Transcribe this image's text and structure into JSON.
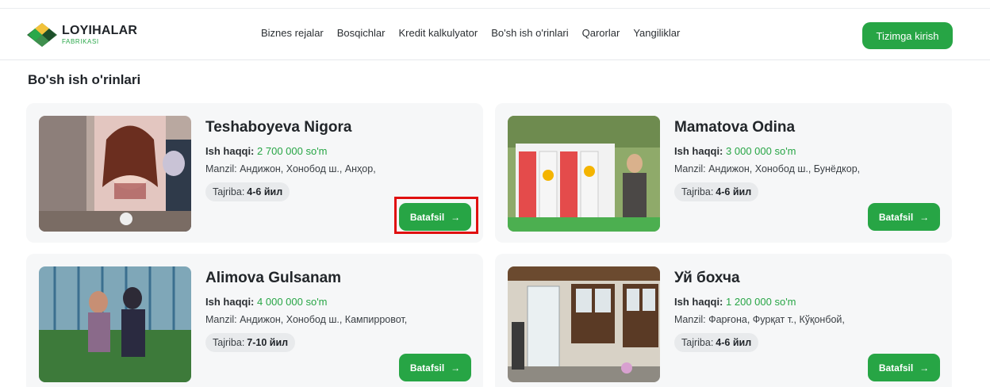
{
  "brand": {
    "title": "LOYIHALAR",
    "subtitle": "FABRIKASI"
  },
  "nav": [
    "Biznes rejalar",
    "Bosqichlar",
    "Kredit kalkulyator",
    "Bo'sh ish o'rinlari",
    "Qarorlar",
    "Yangiliklar"
  ],
  "login_label": "Tizimga kirish",
  "page_title": "Bo'sh ish o'rinlari",
  "labels": {
    "salary": "Ish haqqi:",
    "address": "Manzil:",
    "experience": "Tajriba:",
    "more": "Batafsil",
    "arrow": "→"
  },
  "jobs": [
    {
      "name": "Teshaboyeva Nigora",
      "salary": "2 700 000 so'm",
      "address": "Андижон, Хонобод ш., Анҳор,",
      "experience": "4-6 йил",
      "photo": "beauty-salon-photo"
    },
    {
      "name": "Mamatova Odina",
      "salary": "3 000 000 so'm",
      "address": "Андижон, Хонобод ш., Бунёдкор,",
      "experience": "4-6 йил",
      "photo": "kindergarten-photo"
    },
    {
      "name": "Alimova Gulsanam",
      "salary": "4 000 000 so'm",
      "address": "Андижон, Хонобод ш., Кампирровот,",
      "experience": "7-10 йил",
      "photo": "greenhouse-photo"
    },
    {
      "name": "Уй бохча",
      "salary": "1 200 000 so'm",
      "address": "Фарғона, Фурқат т., Кўқонбой,",
      "experience": "4-6 йил",
      "photo": "house-front-photo"
    }
  ],
  "colors": {
    "accent": "#27a545",
    "highlight": "#e01010",
    "card_bg": "#f6f7f8"
  }
}
